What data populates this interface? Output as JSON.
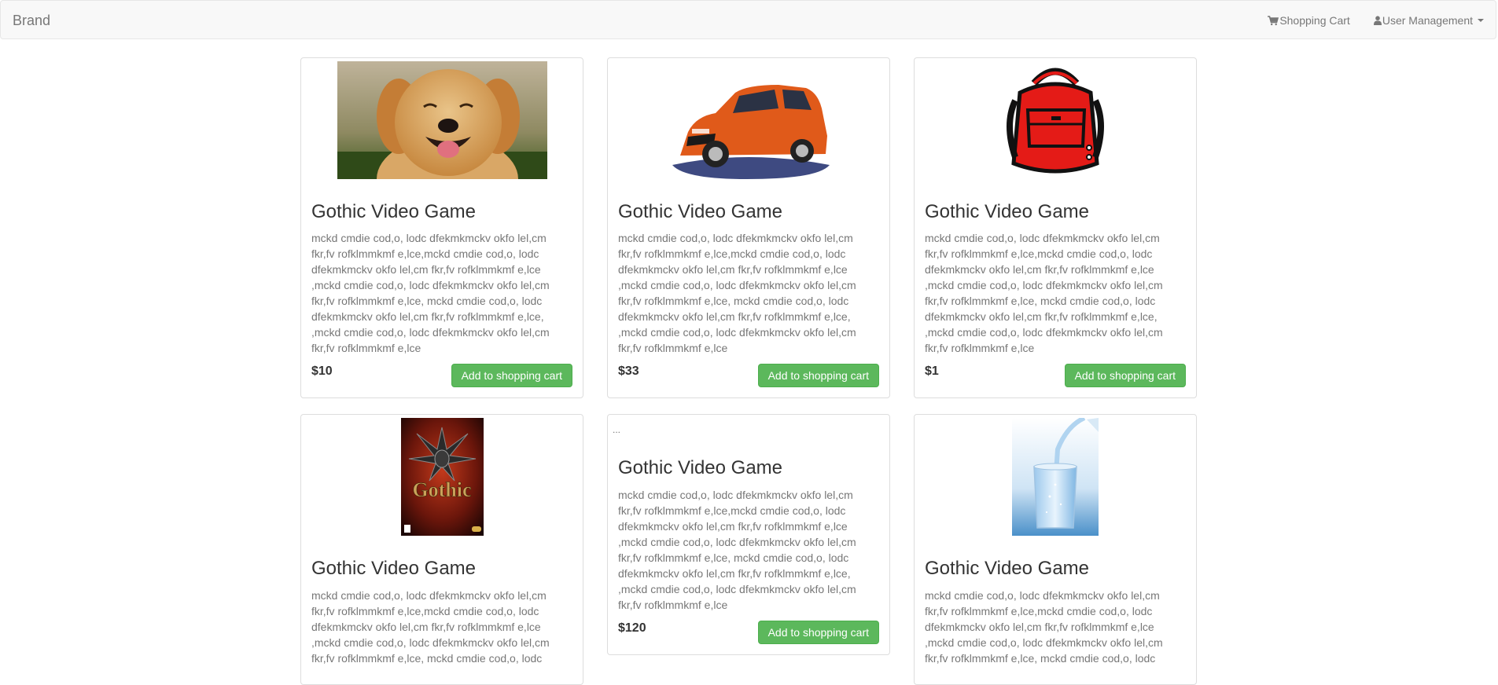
{
  "navbar": {
    "brand": "Brand",
    "cart_label": "Shopping Cart",
    "user_label": "User Management"
  },
  "products": [
    {
      "title": "Gothic Video Game",
      "description": "mckd cmdie cod,o, lodc dfekmkmckv okfo lel,cm fkr,fv rofklmmkmf e,lce,mckd cmdie cod,o, lodc dfekmkmckv okfo lel,cm fkr,fv rofklmmkmf e,lce ,mckd cmdie cod,o, lodc dfekmkmckv okfo lel,cm fkr,fv rofklmmkmf e,lce, mckd cmdie cod,o, lodc dfekmkmckv okfo lel,cm fkr,fv rofklmmkmf e,lce, ,mckd cmdie cod,o, lodc dfekmkmckv okfo lel,cm fkr,fv rofklmmkmf e,lce",
      "price": "$10",
      "button_label": "Add to shopping cart",
      "image": "dog-photo"
    },
    {
      "title": "Gothic Video Game",
      "description": "mckd cmdie cod,o, lodc dfekmkmckv okfo lel,cm fkr,fv rofklmmkmf e,lce,mckd cmdie cod,o, lodc dfekmkmckv okfo lel,cm fkr,fv rofklmmkmf e,lce ,mckd cmdie cod,o, lodc dfekmkmckv okfo lel,cm fkr,fv rofklmmkmf e,lce, mckd cmdie cod,o, lodc dfekmkmckv okfo lel,cm fkr,fv rofklmmkmf e,lce, ,mckd cmdie cod,o, lodc dfekmkmckv okfo lel,cm fkr,fv rofklmmkmf e,lce",
      "price": "$33",
      "button_label": "Add to shopping cart",
      "image": "red-car-drawing"
    },
    {
      "title": "Gothic Video Game",
      "description": "mckd cmdie cod,o, lodc dfekmkmckv okfo lel,cm fkr,fv rofklmmkmf e,lce,mckd cmdie cod,o, lodc dfekmkmckv okfo lel,cm fkr,fv rofklmmkmf e,lce ,mckd cmdie cod,o, lodc dfekmkmckv okfo lel,cm fkr,fv rofklmmkmf e,lce, mckd cmdie cod,o, lodc dfekmkmckv okfo lel,cm fkr,fv rofklmmkmf e,lce, ,mckd cmdie cod,o, lodc dfekmkmckv okfo lel,cm fkr,fv rofklmmkmf e,lce",
      "price": "$1",
      "button_label": "Add to shopping cart",
      "image": "red-backpack-clipart"
    },
    {
      "title": "Gothic Video Game",
      "description": "mckd cmdie cod,o, lodc dfekmkmckv okfo lel,cm fkr,fv rofklmmkmf e,lce,mckd cmdie cod,o, lodc dfekmkmckv okfo lel,cm fkr,fv rofklmmkmf e,lce ,mckd cmdie cod,o, lodc dfekmkmckv okfo lel,cm fkr,fv rofklmmkmf e,lce, mckd cmdie cod,o, lodc",
      "price": "",
      "button_label": "",
      "image": "gothic-game-cover",
      "cover_text": "Gothic"
    },
    {
      "title": "Gothic Video Game",
      "description": "mckd cmdie cod,o, lodc dfekmkmckv okfo lel,cm fkr,fv rofklmmkmf e,lce,mckd cmdie cod,o, lodc dfekmkmckv okfo lel,cm fkr,fv rofklmmkmf e,lce ,mckd cmdie cod,o, lodc dfekmkmckv okfo lel,cm fkr,fv rofklmmkmf e,lce, mckd cmdie cod,o, lodc dfekmkmckv okfo lel,cm fkr,fv rofklmmkmf e,lce, ,mckd cmdie cod,o, lodc dfekmkmckv okfo lel,cm fkr,fv rofklmmkmf e,lce",
      "price": "$120",
      "button_label": "Add to shopping cart",
      "image": "broken-image",
      "broken_alt": "..."
    },
    {
      "title": "Gothic Video Game",
      "description": "mckd cmdie cod,o, lodc dfekmkmckv okfo lel,cm fkr,fv rofklmmkmf e,lce,mckd cmdie cod,o, lodc dfekmkmckv okfo lel,cm fkr,fv rofklmmkmf e,lce ,mckd cmdie cod,o, lodc dfekmkmckv okfo lel,cm fkr,fv rofklmmkmf e,lce, mckd cmdie cod,o, lodc",
      "price": "",
      "button_label": "",
      "image": "water-glass-photo"
    }
  ],
  "colors": {
    "navbar_bg": "#f8f8f8",
    "nav_text": "#777777",
    "button_bg": "#5cb85c",
    "border": "#dddddd"
  }
}
